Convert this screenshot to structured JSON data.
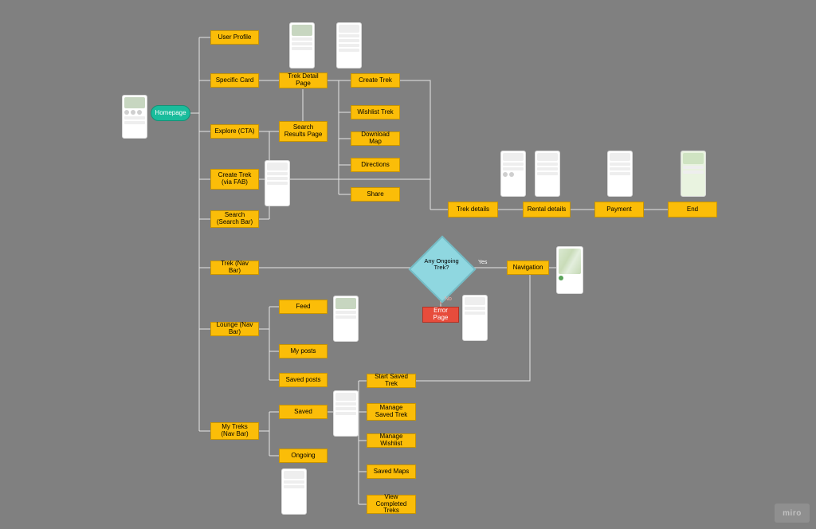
{
  "tool_watermark": "miro",
  "start": {
    "label": "Homepage"
  },
  "col1": {
    "user_profile": "User Profile",
    "specific_card": "Specific Card",
    "explore_cta": "Explore (CTA)",
    "create_trek_fab": "Create Trek (via FAB)",
    "search_bar": "Search (Search Bar)",
    "trek_nav": "Trek (Nav Bar)",
    "lounge_nav": "Lounge (Nav Bar)",
    "my_treks_nav": "My Treks (Nav Bar)"
  },
  "col2": {
    "trek_detail": "Trek Detail Page",
    "search_results": "Search Results Page",
    "feed": "Feed",
    "my_posts": "My posts",
    "saved_posts": "Saved posts",
    "saved": "Saved",
    "ongoing": "Ongoing"
  },
  "col3": {
    "create_trek": "Create Trek",
    "wishlist_trek": "Wishlist Trek",
    "download_map": "Download Map",
    "directions": "Directions",
    "share": "Share",
    "start_saved": "Start Saved Trek",
    "manage_saved": "Manage Saved Trek",
    "manage_wishlist": "Manage Wishlist",
    "saved_maps": "Saved Maps",
    "view_completed": "View Completed Treks"
  },
  "flow_right": {
    "trek_details": "Trek details",
    "rental_details": "Rental details",
    "payment": "Payment",
    "end": "End"
  },
  "decision": {
    "label": "Any Ongoing Trek?",
    "yes": "Yes",
    "no": "No"
  },
  "navigation": "Navigation",
  "error_page": "Error Page"
}
